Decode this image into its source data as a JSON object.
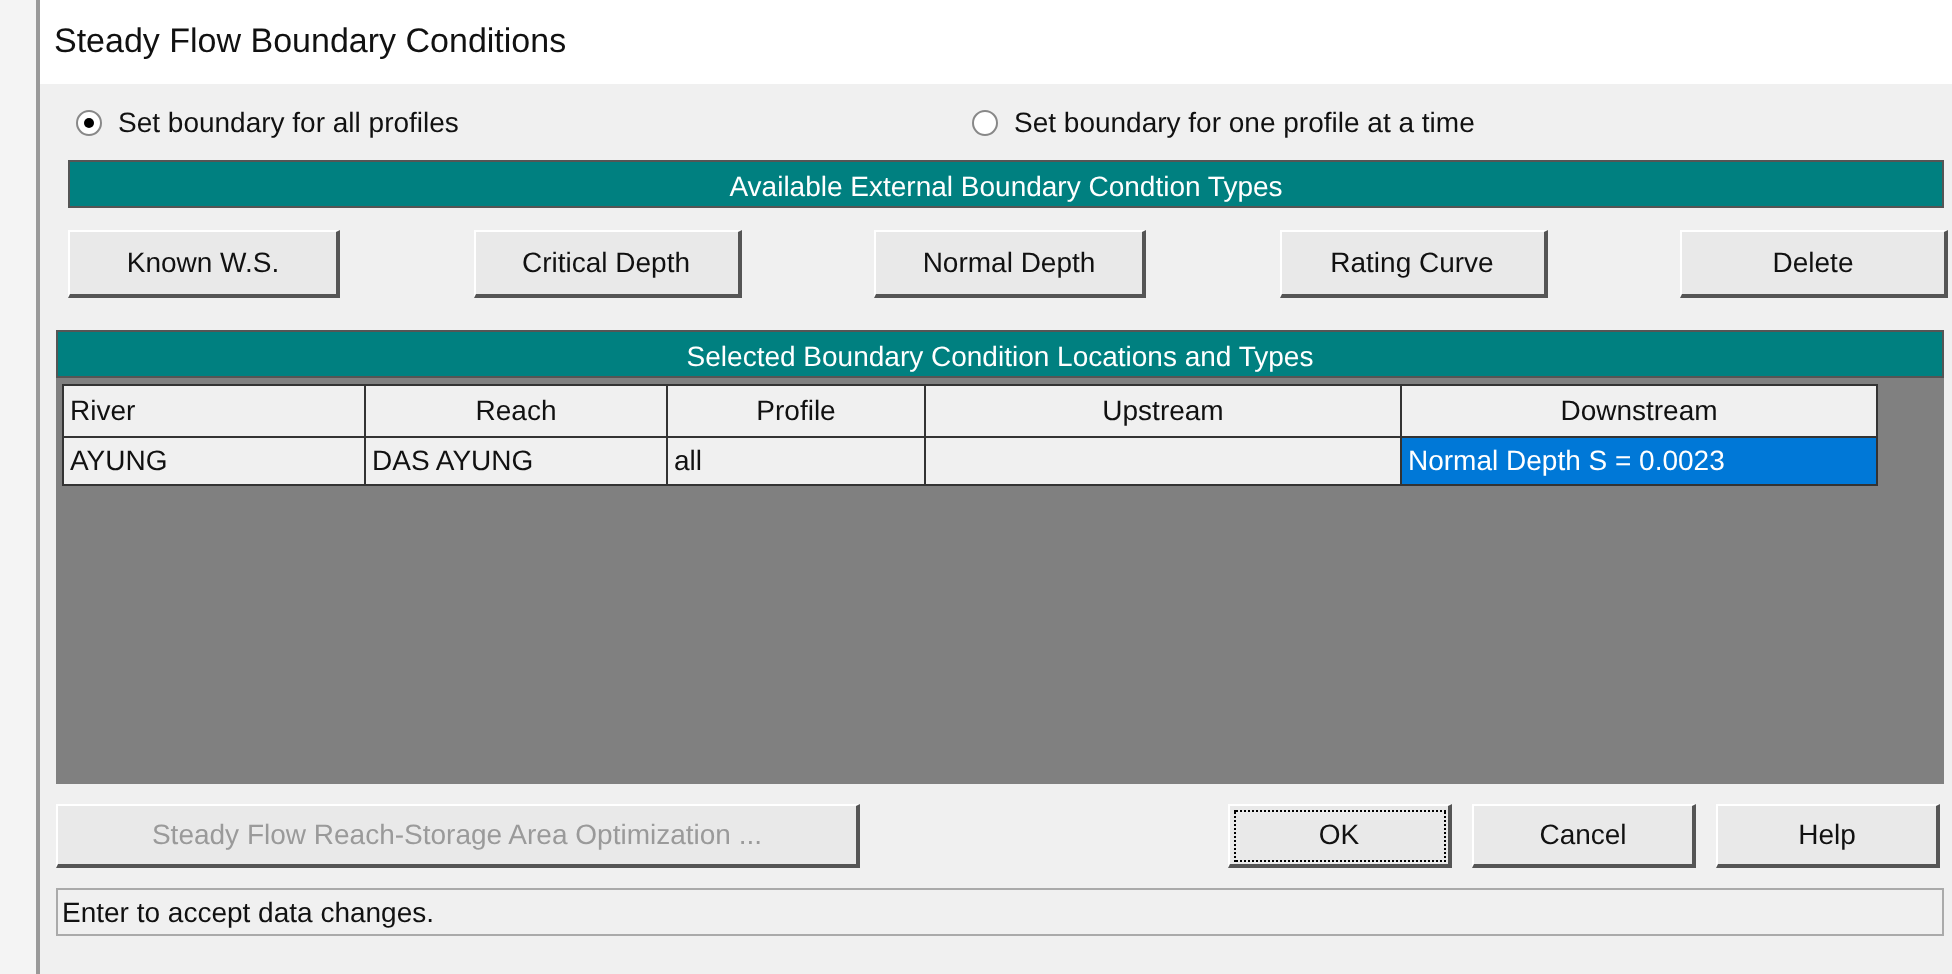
{
  "window": {
    "title": "Steady Flow Boundary Conditions"
  },
  "radios": [
    {
      "label": "Set boundary for all profiles",
      "selected": true
    },
    {
      "label": "Set boundary for one profile at a time",
      "selected": false
    }
  ],
  "types_header": "Available External Boundary Condtion Types",
  "type_buttons": [
    "Known W.S.",
    "Critical Depth",
    "Normal Depth",
    "Rating Curve",
    "Delete"
  ],
  "table": {
    "title": "Selected Boundary Condition Locations and Types",
    "columns": [
      "River",
      "Reach",
      "Profile",
      "Upstream",
      "Downstream"
    ],
    "rows": [
      {
        "cells": [
          {
            "text": "AYUNG",
            "selected": false
          },
          {
            "text": "DAS AYUNG",
            "selected": false
          },
          {
            "text": "all",
            "selected": false
          },
          {
            "text": "",
            "selected": false
          },
          {
            "text": "Normal Depth S = 0.0023",
            "selected": true
          }
        ]
      }
    ]
  },
  "buttons": [
    {
      "label": "Steady Flow Reach-Storage Area Optimization ...",
      "disabled": true,
      "focused": false
    },
    {
      "label": "OK",
      "disabled": false,
      "focused": true
    },
    {
      "label": "Cancel",
      "disabled": false,
      "focused": false
    },
    {
      "label": "Help",
      "disabled": false,
      "focused": false
    }
  ],
  "status_bar": "Enter to accept data changes."
}
